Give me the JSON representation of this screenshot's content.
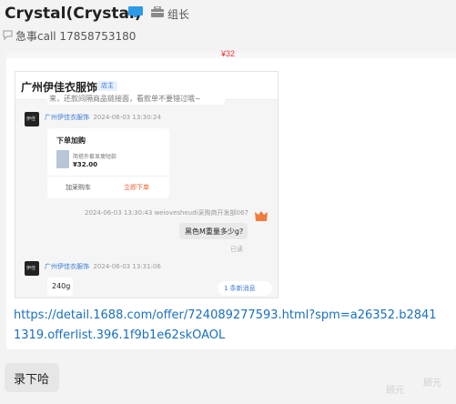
{
  "header": {
    "name": "Crystal(Crystal)",
    "role_label": "组长",
    "subtitle": "急事call 17858753180"
  },
  "message": {
    "top_fragment": "¥32",
    "screenshot": {
      "store_name": "广州伊佳衣服饰",
      "store_tag": "店主",
      "cut_text": "来，还款间隔商品链接面，看款单不要错过哦~",
      "seller_name": "广州伊佳衣服饰",
      "time1": "2024-06-03 13:30:24",
      "product": {
        "title": "下单加购",
        "desc": "简搭外套显瘦短款",
        "price": "¥32.00",
        "btn_cart": "加采购车",
        "btn_buy": "立即下单"
      },
      "buyer_meta": "2024-06-03 13:30:43  weiovesheudi采购商开发部067",
      "buyer_msg": "黑色M重量多少g?",
      "read_label": "已读",
      "time2": "2024-06-03 13:31:06",
      "reply": "240g",
      "new_msgs": "1 条新消息"
    },
    "link": "https://detail.1688.com/offer/724089277593.html?spm=a26352.b28411319.offerlist.396.1f9b1e62skOAOL"
  },
  "reply_bubble": "录下哈",
  "watermark": "顾元"
}
